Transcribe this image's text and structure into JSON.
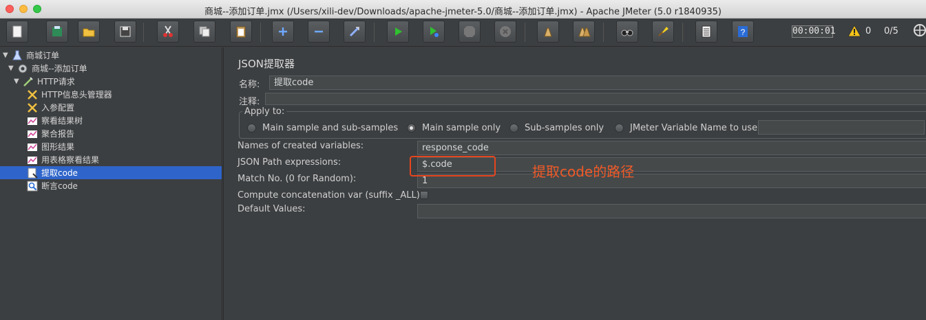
{
  "window": {
    "title": "商城--添加订单.jmx (/Users/xili-dev/Downloads/apache-jmeter-5.0/商城--添加订单.jmx) - Apache JMeter (5.0 r1840935)"
  },
  "toolbar": {
    "timer": "00:00:01",
    "warnings": "0",
    "threads": "0/5",
    "buttons": [
      "new-icon",
      "templates-icon",
      "open-icon",
      "save-icon",
      "cut-icon",
      "copy-icon",
      "paste-icon",
      "expand-icon",
      "collapse-icon",
      "toggle-icon",
      "start-icon",
      "start-no-pause-icon",
      "stop-icon",
      "shutdown-icon",
      "clear-icon",
      "clear-all-icon",
      "search-icon",
      "reset-search-icon",
      "function-helper-icon",
      "help-icon"
    ]
  },
  "tree": {
    "nodes": [
      {
        "label": "商城订单",
        "icon": "test-plan-icon"
      },
      {
        "label": "商城--添加订单",
        "icon": "thread-group-icon"
      },
      {
        "label": "HTTP请求",
        "icon": "sampler-icon"
      },
      {
        "label": "HTTP信息头管理器",
        "icon": "config-icon"
      },
      {
        "label": "入参配置",
        "icon": "config-icon"
      },
      {
        "label": "察看结果树",
        "icon": "listener-icon"
      },
      {
        "label": "聚合报告",
        "icon": "listener-icon"
      },
      {
        "label": "图形结果",
        "icon": "listener-icon"
      },
      {
        "label": "用表格察看结果",
        "icon": "listener-icon"
      },
      {
        "label": "提取code",
        "icon": "extractor-icon"
      },
      {
        "label": "断言code",
        "icon": "assertion-icon"
      }
    ]
  },
  "panel": {
    "title": "JSON提取器",
    "name_label": "名称:",
    "name_value": "提取code",
    "comment_label": "注释:",
    "apply_to": {
      "legend": "Apply to:",
      "options": [
        {
          "label": "Main sample and sub-samples",
          "selected": false
        },
        {
          "label": "Main sample only",
          "selected": true
        },
        {
          "label": "Sub-samples only",
          "selected": false
        },
        {
          "label": "JMeter Variable Name to use",
          "selected": false
        }
      ]
    },
    "fields": [
      {
        "label": "Names of created variables:",
        "value": "response_code"
      },
      {
        "label": "JSON Path expressions:",
        "value": "$.code"
      },
      {
        "label": "Match No. (0 for Random):",
        "value": "1"
      },
      {
        "label": "Compute concatenation var (suffix _ALL):",
        "value": ""
      },
      {
        "label": "Default Values:",
        "value": ""
      }
    ],
    "annotation": "提取code的路径"
  },
  "colors": {
    "background": "#3c3f41",
    "selection": "#2f65ca",
    "annotation": "#f05a28"
  }
}
